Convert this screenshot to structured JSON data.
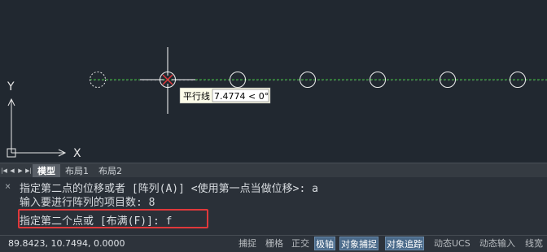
{
  "canvas": {
    "tooltip_label": "平行线",
    "tooltip_value": "7.4774 < 0°",
    "axis_y": "Y",
    "axis_x": "X"
  },
  "layout_tabs": {
    "items": [
      "模型",
      "布局1",
      "布局2"
    ],
    "active": "模型"
  },
  "command": {
    "close_icon": "×",
    "line1": "指定第二点的位移或者 [阵列(A)] <使用第一点当做位移>: a",
    "line2": "输入要进行阵列的项目数: 8",
    "input": "指定第二个点或 [布满(F)]: f"
  },
  "status": {
    "coords": "89.8423, 10.7494, 0.0000",
    "buttons": [
      "捕捉",
      "栅格",
      "正交",
      "极轴",
      "对象捕捉",
      "对象追踪",
      "动态UCS",
      "动态输入",
      "线宽"
    ],
    "active_buttons": [
      "极轴",
      "对象捕捉",
      "对象追踪"
    ]
  },
  "colors": {
    "background": "#212830",
    "tracking_line": "#3fbf3f",
    "highlight_box": "#e0383b"
  }
}
